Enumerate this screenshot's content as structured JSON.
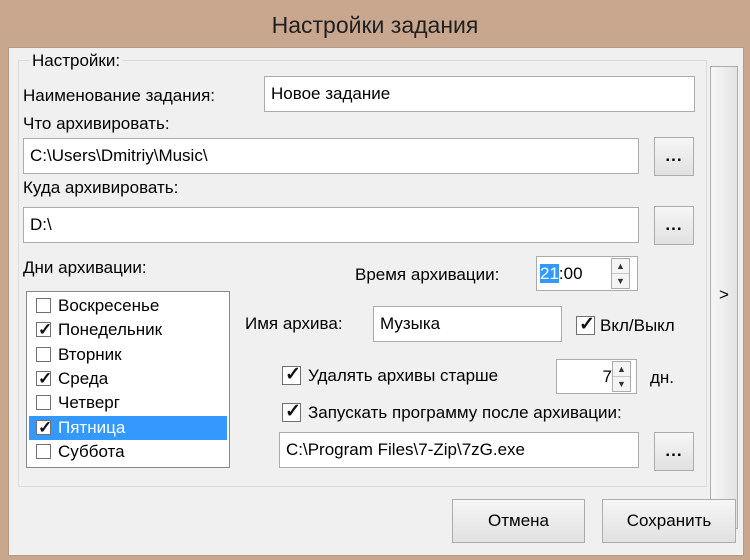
{
  "window": {
    "title": "Настройки задания"
  },
  "group": {
    "title": "Настройки:"
  },
  "task_name": {
    "label": "Наименование задания:",
    "value": "Новое задание"
  },
  "source": {
    "label": "Что архивировать:",
    "value": "C:\\Users\\Dmitriy\\Music\\",
    "browse_label": "..."
  },
  "destination": {
    "label": "Куда архивировать:",
    "value": "D:\\",
    "browse_label": "..."
  },
  "days": {
    "label": "Дни архивации:",
    "items": [
      {
        "label": "Воскресенье",
        "mark": ""
      },
      {
        "label": "Понедельник",
        "mark": "✓"
      },
      {
        "label": "Вторник",
        "mark": ""
      },
      {
        "label": "Среда",
        "mark": "✓"
      },
      {
        "label": "Четверг",
        "mark": ""
      },
      {
        "label": "Пятница",
        "mark": "✓"
      },
      {
        "label": "Суббота",
        "mark": ""
      }
    ],
    "selected_index": 5
  },
  "time": {
    "label": "Время архивации:",
    "hours": "21",
    "rest": ":00"
  },
  "archive_name": {
    "label": "Имя архива:",
    "value": "Музыка"
  },
  "enabled": {
    "label": "Вкл/Выкл",
    "mark": "✓"
  },
  "delete_old": {
    "label": "Удалять архивы старше",
    "mark": "✓",
    "value": "7",
    "unit": "дн."
  },
  "run_after": {
    "label": "Запускать программу после архивации:",
    "mark": "✓",
    "value": "C:\\Program Files\\7-Zip\\7zG.exe",
    "browse_label": "..."
  },
  "side_button": {
    "label": ">"
  },
  "buttons": {
    "cancel": "Отмена",
    "save": "Сохранить"
  },
  "colors": {
    "title_bar": "#c9a78f",
    "client": "#f0f0f0",
    "selection": "#3399ff"
  }
}
